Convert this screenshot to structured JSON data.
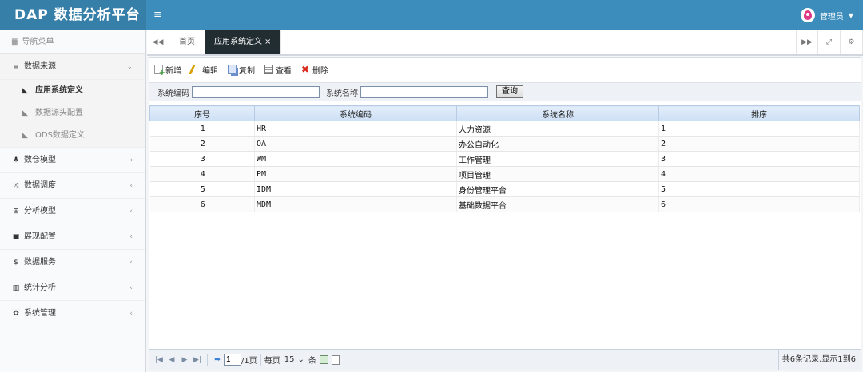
{
  "header": {
    "brand": "DAP 数据分析平台",
    "menu_icon": "≡",
    "user_name": "管理员"
  },
  "sidebar": {
    "title": "导航菜单",
    "menus": [
      {
        "label": "数据来源",
        "icon": "database-icon",
        "children": [
          "应用系统定义",
          "数据源头配置",
          "ODS数据定义"
        ],
        "active_child": "应用系统定义"
      },
      {
        "label": "数仓模型",
        "icon": "cubes-icon"
      },
      {
        "label": "数据调度",
        "icon": "random-icon"
      },
      {
        "label": "分析模型",
        "icon": "sitemap-icon"
      },
      {
        "label": "展现配置",
        "icon": "film-icon"
      },
      {
        "label": "数据服务",
        "icon": "dollar-icon"
      },
      {
        "label": "统计分析",
        "icon": "bar-chart-icon"
      },
      {
        "label": "系统管理",
        "icon": "gear-icon"
      }
    ]
  },
  "tabs": {
    "home": "首页",
    "active": "应用系统定义",
    "close": "×"
  },
  "toolbar": {
    "new": "新增",
    "edit": "编辑",
    "copy": "复制",
    "view": "查看",
    "delete": "删除"
  },
  "search": {
    "code_label": "系统编码",
    "name_label": "系统名称",
    "code_value": "",
    "name_value": "",
    "button": "查询"
  },
  "table": {
    "headers": [
      "序号",
      "系统编码",
      "系统名称",
      "排序"
    ],
    "rows": [
      [
        "1",
        "HR",
        "人力资源",
        "1"
      ],
      [
        "2",
        "OA",
        "办公自动化",
        "2"
      ],
      [
        "3",
        "WM",
        "工作管理",
        "3"
      ],
      [
        "4",
        "PM",
        "项目管理",
        "4"
      ],
      [
        "5",
        "IDM",
        "身份管理平台",
        "5"
      ],
      [
        "6",
        "MDM",
        "基础数据平台",
        "6"
      ]
    ]
  },
  "pager": {
    "page_value": "1",
    "of_pages": "/1页",
    "per_page_label": "每页",
    "per_page_value": "15",
    "unit": "条",
    "info": "共6条记录,显示1到6"
  }
}
